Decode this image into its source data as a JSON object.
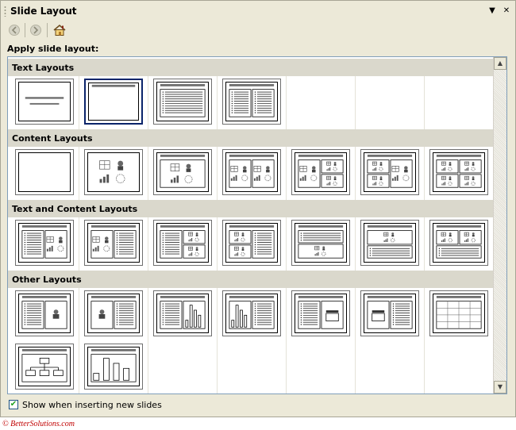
{
  "pane": {
    "title": "Slide Layout",
    "dropdown_glyph": "▼",
    "close_glyph": "✕",
    "nav": {
      "back_icon": "back-arrow-icon",
      "forward_icon": "forward-arrow-icon",
      "home_icon": "home-icon"
    },
    "apply_label": "Apply slide layout:",
    "show_option": {
      "label": "Show when inserting new slides",
      "checked": true,
      "check_glyph": "✔"
    }
  },
  "scrollbar": {
    "up_glyph": "▲",
    "down_glyph": "▼"
  },
  "sections": [
    {
      "name": "Text Layouts",
      "layouts": [
        {
          "name": "title-slide",
          "selected": false
        },
        {
          "name": "title-only",
          "selected": true
        },
        {
          "name": "title-and-text",
          "selected": false
        },
        {
          "name": "title-and-2-column-text",
          "selected": false
        }
      ]
    },
    {
      "name": "Content Layouts",
      "layouts": [
        {
          "name": "blank",
          "selected": false
        },
        {
          "name": "content",
          "selected": false
        },
        {
          "name": "title-and-content",
          "selected": false
        },
        {
          "name": "title-and-2-content",
          "selected": false
        },
        {
          "name": "title-content-and-2-content",
          "selected": false
        },
        {
          "name": "title-2-content-and-content",
          "selected": false
        },
        {
          "name": "title-and-4-content",
          "selected": false
        }
      ]
    },
    {
      "name": "Text and Content Layouts",
      "layouts": [
        {
          "name": "title-text-and-content",
          "selected": false
        },
        {
          "name": "title-content-and-text",
          "selected": false
        },
        {
          "name": "title-text-and-2-content",
          "selected": false
        },
        {
          "name": "title-2-content-and-text",
          "selected": false
        },
        {
          "name": "title-text-over-content",
          "selected": false
        },
        {
          "name": "title-content-over-text",
          "selected": false
        },
        {
          "name": "title-2-content-over-text",
          "selected": false
        }
      ]
    },
    {
      "name": "Other Layouts",
      "layouts": [
        {
          "name": "title-text-and-clip-art",
          "selected": false
        },
        {
          "name": "title-clip-art-and-text",
          "selected": false
        },
        {
          "name": "title-text-and-chart",
          "selected": false
        },
        {
          "name": "title-chart-and-text",
          "selected": false
        },
        {
          "name": "title-text-and-media-clip",
          "selected": false
        },
        {
          "name": "title-media-clip-and-text",
          "selected": false
        },
        {
          "name": "title-and-table",
          "selected": false
        },
        {
          "name": "title-and-diagram",
          "selected": false
        },
        {
          "name": "title-and-chart",
          "selected": false
        }
      ]
    }
  ],
  "copyright": "© BetterSolutions.com",
  "colors": {
    "pane_bg": "#ece9d8",
    "section_bg": "#dad8cc",
    "selection_border": "#0a246a",
    "copyright_text": "#c00000"
  }
}
